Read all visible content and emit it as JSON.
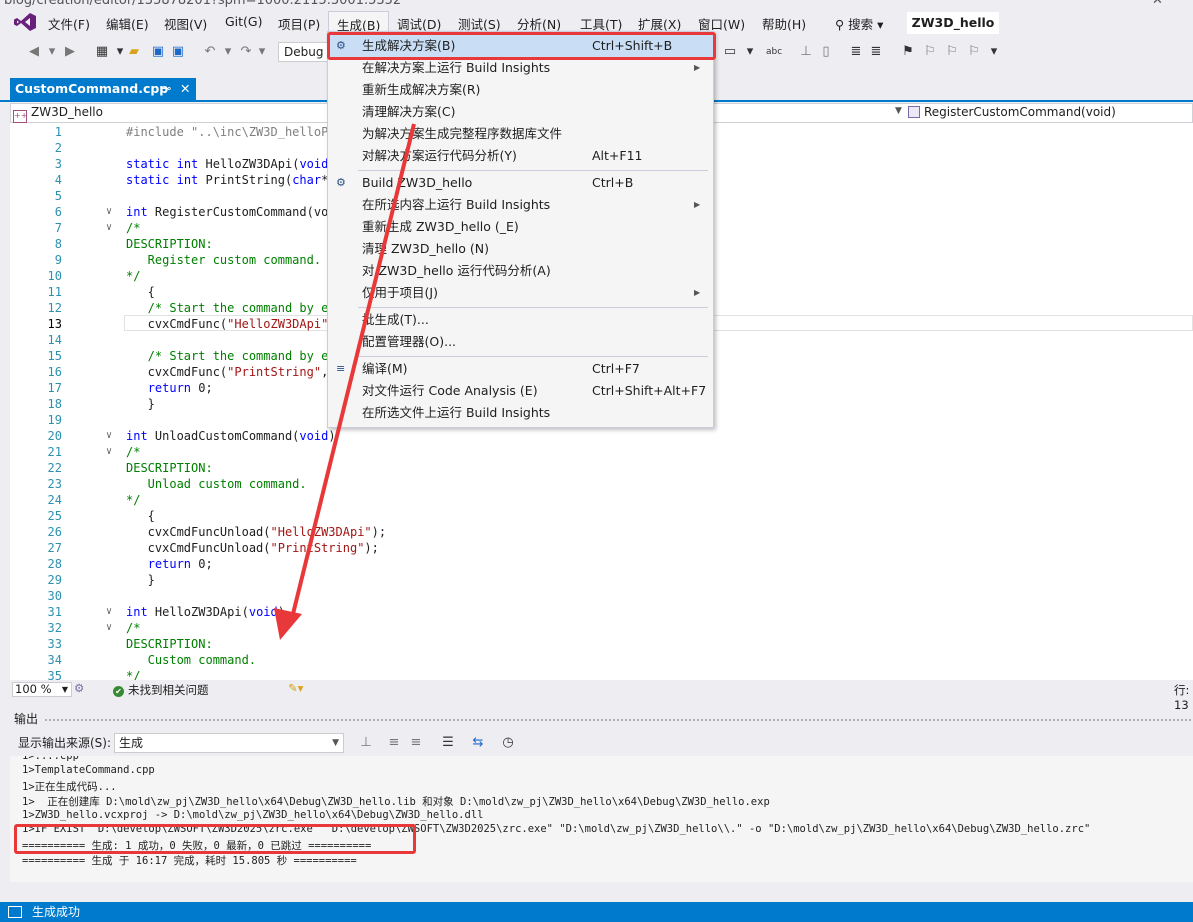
{
  "browser": {
    "url_fragment": "blog/creation/editor/135878201?spm=1000.2115.3001.5352",
    "close_glyph": "✕"
  },
  "menubar": {
    "items": [
      "文件(F)",
      "编辑(E)",
      "视图(V)",
      "Git(G)",
      "项目(P)",
      "生成(B)",
      "调试(D)",
      "测试(S)",
      "分析(N)",
      "工具(T)",
      "扩展(X)",
      "窗口(W)",
      "帮助(H)"
    ],
    "search": "搜索 ▾",
    "project": "ZW3D_hello"
  },
  "toolbar": {
    "config": "Debug"
  },
  "tab": {
    "label": "CustomCommand.cpp",
    "pin": "⊸",
    "close": "✕"
  },
  "navbar": {
    "scope": "ZW3D_hello",
    "member": "RegisterCustomCommand(void)"
  },
  "editor": {
    "current_line": 13,
    "lines": [
      {
        "n": "1",
        "fold": "",
        "t": "#include \"..\\inc\\ZW3D_helloPr",
        "c": "pp"
      },
      {
        "n": "2",
        "fold": "",
        "t": "",
        "c": ""
      },
      {
        "n": "3",
        "fold": "",
        "t": "static int HelloZW3DApi(void)",
        "c": "kw"
      },
      {
        "n": "4",
        "fold": "",
        "t": "static int PrintString(char*",
        "c": "kw"
      },
      {
        "n": "5",
        "fold": "",
        "t": "",
        "c": ""
      },
      {
        "n": "6",
        "fold": "∨",
        "t": "int RegisterCustomCommand(voi",
        "c": "kw"
      },
      {
        "n": "7",
        "fold": "∨",
        "t": "/*",
        "c": "cmt"
      },
      {
        "n": "8",
        "fold": "",
        "t": "DESCRIPTION:",
        "c": "cmt"
      },
      {
        "n": "9",
        "fold": "",
        "t": "   Register custom command.",
        "c": "cmt"
      },
      {
        "n": "10",
        "fold": "",
        "t": "*/",
        "c": "cmt"
      },
      {
        "n": "11",
        "fold": "",
        "t": "   {",
        "c": ""
      },
      {
        "n": "12",
        "fold": "",
        "t": "   /* Start the command by en",
        "c": "cmt"
      },
      {
        "n": "13",
        "fold": "",
        "t": "   cvxCmdFunc(\"HelloZW3DApi\",",
        "c": "str"
      },
      {
        "n": "14",
        "fold": "",
        "t": "",
        "c": ""
      },
      {
        "n": "15",
        "fold": "",
        "t": "   /* Start the command by en",
        "c": "cmt"
      },
      {
        "n": "16",
        "fold": "",
        "t": "   cvxCmdFunc(\"PrintString\",",
        "c": "str"
      },
      {
        "n": "17",
        "fold": "",
        "t": "   return 0;",
        "c": "kw"
      },
      {
        "n": "18",
        "fold": "",
        "t": "   }",
        "c": ""
      },
      {
        "n": "19",
        "fold": "",
        "t": "",
        "c": ""
      },
      {
        "n": "20",
        "fold": "∨",
        "t": "int UnloadCustomCommand(void)",
        "c": "kw"
      },
      {
        "n": "21",
        "fold": "∨",
        "t": "/*",
        "c": "cmt"
      },
      {
        "n": "22",
        "fold": "",
        "t": "DESCRIPTION:",
        "c": "cmt"
      },
      {
        "n": "23",
        "fold": "",
        "t": "   Unload custom command.",
        "c": "cmt"
      },
      {
        "n": "24",
        "fold": "",
        "t": "*/",
        "c": "cmt"
      },
      {
        "n": "25",
        "fold": "",
        "t": "   {",
        "c": ""
      },
      {
        "n": "26",
        "fold": "",
        "t": "   cvxCmdFuncUnload(\"HelloZW3DApi\");",
        "c": "str"
      },
      {
        "n": "27",
        "fold": "",
        "t": "   cvxCmdFuncUnload(\"PrintString\");",
        "c": "str"
      },
      {
        "n": "28",
        "fold": "",
        "t": "   return 0;",
        "c": "kw"
      },
      {
        "n": "29",
        "fold": "",
        "t": "   }",
        "c": ""
      },
      {
        "n": "30",
        "fold": "",
        "t": "",
        "c": ""
      },
      {
        "n": "31",
        "fold": "∨",
        "t": "int HelloZW3DApi(void)",
        "c": "kw"
      },
      {
        "n": "32",
        "fold": "∨",
        "t": "/*",
        "c": "cmt"
      },
      {
        "n": "33",
        "fold": "",
        "t": "DESCRIPTION:",
        "c": "cmt"
      },
      {
        "n": "34",
        "fold": "",
        "t": "   Custom command.",
        "c": "cmt"
      },
      {
        "n": "35",
        "fold": "",
        "t": "*/",
        "c": "cmt"
      }
    ]
  },
  "editor_status": {
    "zoom": "100 %",
    "issues": "未找到相关问题",
    "position": "行: 13"
  },
  "output": {
    "title": "输出",
    "source_label": "显示输出来源(S):",
    "source_value": "生成",
    "lines": [
      "1>TemplateCommand.cpp",
      "1>正在生成代码...",
      "1>  正在创建库 D:\\mold\\zw_pj\\ZW3D_hello\\x64\\Debug\\ZW3D_hello.lib 和对象 D:\\mold\\zw_pj\\ZW3D_hello\\x64\\Debug\\ZW3D_hello.exp",
      "1>ZW3D_hello.vcxproj -> D:\\mold\\zw_pj\\ZW3D_hello\\x64\\Debug\\ZW3D_hello.dll",
      "1>IF EXIST \"D:\\develop\\ZWSOFT\\ZW3D2025\\zrc.exe\" \"D:\\develop\\ZWSOFT\\ZW3D2025\\zrc.exe\" \"D:\\mold\\zw_pj\\ZW3D_hello\\\\.\" -o \"D:\\mold\\zw_pj\\ZW3D_hello\\x64\\Debug\\ZW3D_hello.zrc\"",
      "========== 生成: 1 成功，0 失败，0 最新，0 已跳过 ==========",
      "========== 生成 于 16:17 完成，耗时 15.805 秒 =========="
    ]
  },
  "statusbar": {
    "text": "生成成功"
  },
  "build_menu": {
    "items": [
      {
        "label": "生成解决方案(B)",
        "shortcut": "Ctrl+Shift+B",
        "icon": "build-icon",
        "sub": false
      },
      {
        "label": "在解决方案上运行 Build Insights",
        "shortcut": "",
        "icon": "",
        "sub": true
      },
      {
        "label": "重新生成解决方案(R)",
        "shortcut": "",
        "icon": "",
        "sub": false
      },
      {
        "label": "清理解决方案(C)",
        "shortcut": "",
        "icon": "",
        "sub": false
      },
      {
        "label": "为解决方案生成完整程序数据库文件",
        "shortcut": "",
        "icon": "",
        "sub": false
      },
      {
        "label": "对解决方案运行代码分析(Y)",
        "shortcut": "Alt+F11",
        "icon": "",
        "sub": false
      },
      {
        "label": "Build ZW3D_hello",
        "shortcut": "Ctrl+B",
        "icon": "build-icon",
        "sub": false
      },
      {
        "label": "在所选内容上运行 Build Insights",
        "shortcut": "",
        "icon": "",
        "sub": true
      },
      {
        "label": "重新生成 ZW3D_hello (_E)",
        "shortcut": "",
        "icon": "",
        "sub": false
      },
      {
        "label": "清理 ZW3D_hello (N)",
        "shortcut": "",
        "icon": "",
        "sub": false
      },
      {
        "label": "对 ZW3D_hello 运行代码分析(A)",
        "shortcut": "",
        "icon": "",
        "sub": false
      },
      {
        "label": "仅用于项目(J)",
        "shortcut": "",
        "icon": "",
        "sub": true
      },
      {
        "label": "批生成(T)...",
        "shortcut": "",
        "icon": "",
        "sub": false
      },
      {
        "label": "配置管理器(O)...",
        "shortcut": "",
        "icon": "",
        "sub": false
      },
      {
        "label": "编译(M)",
        "shortcut": "Ctrl+F7",
        "icon": "compile-icon",
        "sub": false
      },
      {
        "label": "对文件运行 Code Analysis (E)",
        "shortcut": "Ctrl+Shift+Alt+F7",
        "icon": "",
        "sub": false
      },
      {
        "label": "在所选文件上运行 Build Insights",
        "shortcut": "",
        "icon": "",
        "sub": false
      }
    ]
  },
  "colors": {
    "accent": "#007acc",
    "annotation": "#e8383a",
    "menu_highlight": "#c9def5"
  }
}
